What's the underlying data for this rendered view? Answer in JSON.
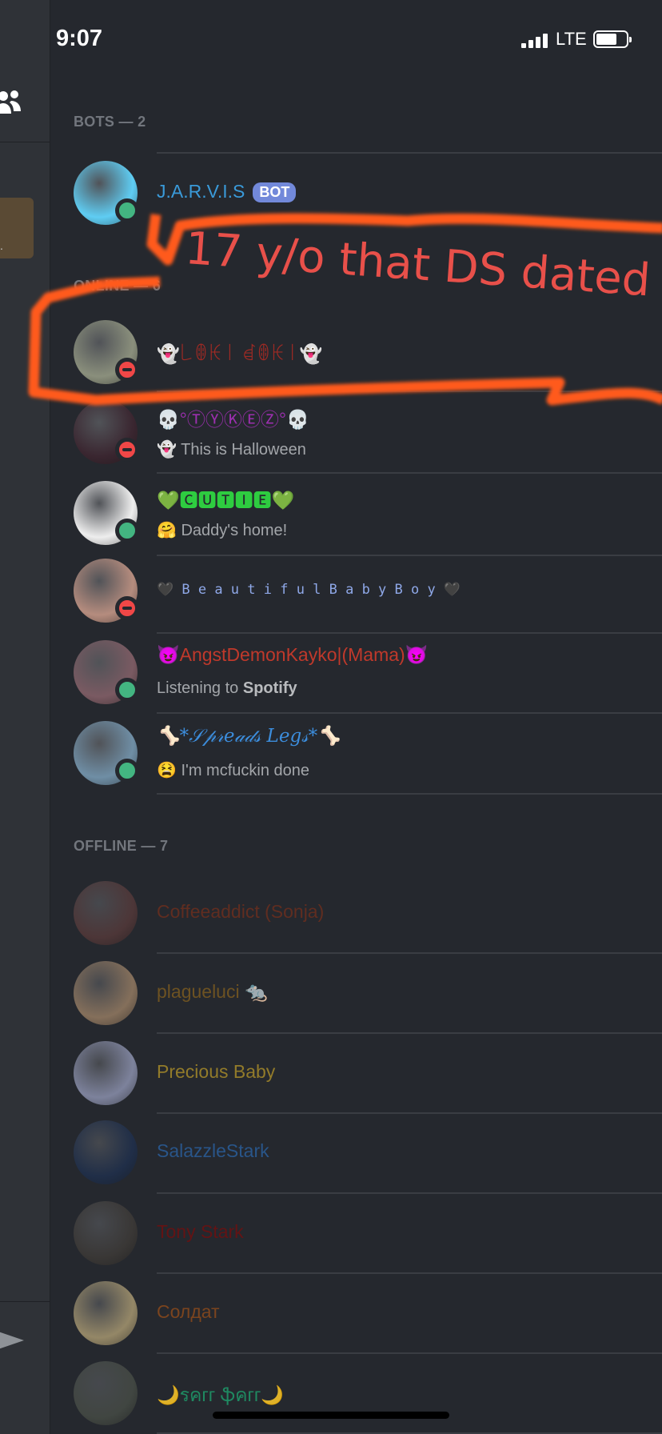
{
  "status_bar": {
    "time": "9:07",
    "network": "LTE",
    "battery_level": 0.7
  },
  "left_panel": {
    "card_fragment": "."
  },
  "sections": {
    "bots": "BOTS — 2",
    "online": "ONLINE — 6",
    "offline": "OFFLINE — 7"
  },
  "annotation": {
    "text": "17 y/o that DS dated",
    "color": "#e8504a",
    "stroke_color": "#ff5a1a"
  },
  "members": [
    {
      "name": "J.A.R.V.I.S",
      "tag": "BOT",
      "status": "online",
      "color": "#3a9ad9",
      "avatar": "#5fcdf3"
    },
    {
      "name": "👻꒒ꂦꀘ꒐ ꀸꂦꀘ꒐👻",
      "status": "dnd",
      "color": "#a02a24",
      "avatar": "#8a8f7c"
    },
    {
      "name": "💀°ⓉⓎⓀⒺⓏ°💀",
      "sub": "👻 This is Halloween",
      "status": "dnd",
      "color": "#9b2fae",
      "avatar": "#3a2630"
    },
    {
      "name": "💚🅲🆄🆃🅸🅴💚",
      "sub": "🤗 Daddy's home!",
      "status": "online",
      "color": "#2ecc40",
      "avatar": "#eeeeee"
    },
    {
      "name": "🖤 B e a u t i f u l  B a b y  B o y 🖤",
      "status": "dnd",
      "color": "#8fa8e8",
      "avatar": "#b58c7e"
    },
    {
      "name": "😈AngstDemonKayko|(Mama)😈",
      "sub_prefix": "Listening to ",
      "sub_bold": "Spotify",
      "status": "online",
      "color": "#c0392b",
      "avatar": "#7a5a62"
    },
    {
      "name": "🦴*𝒮𝓅𝓇𝑒𝒶𝒹𝓈 𝐿𝑒𝑔𝓈*🦴",
      "sub": "😫 I'm mcfuckin done",
      "status": "online",
      "color": "#3c8ddc",
      "avatar": "#6f8ea5"
    },
    {
      "name": "Coffeeaddict (Sonja)",
      "status": "offline",
      "color": "#6b2e1e",
      "avatar": "#5a3b3b"
    },
    {
      "name": "plagueluci 🐀",
      "status": "offline",
      "color": "#7a5a20",
      "avatar": "#a4876a"
    },
    {
      "name": "Precious Baby",
      "status": "offline",
      "color": "#a68a2a",
      "avatar": "#9aa0c0"
    },
    {
      "name": "SalazzleStark",
      "status": "offline",
      "color": "#2a5e9a",
      "avatar": "#1e3050"
    },
    {
      "name": "Tony Stark",
      "status": "offline",
      "color": "#6e1010",
      "avatar": "#403c38"
    },
    {
      "name": "Солдат",
      "status": "offline",
      "color": "#8a4a1c",
      "avatar": "#b9a77a"
    },
    {
      "name": "🌙รคгг ֆคгг🌙",
      "status": "offline",
      "color": "#1e9a6a",
      "avatar": "#4a5048"
    }
  ]
}
